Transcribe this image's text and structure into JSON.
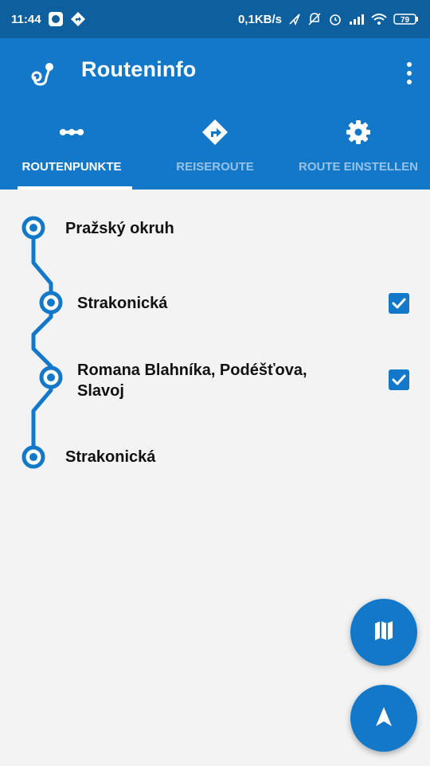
{
  "status_bar": {
    "time": "11:44",
    "network_speed": "0,1KB/s",
    "battery": "79",
    "icons": [
      "messenger-icon",
      "location-arrow-icon",
      "nfc-icon",
      "alarm-icon",
      "signal-icon",
      "wifi-icon",
      "battery-icon"
    ]
  },
  "app_bar": {
    "title": "Routeninfo",
    "logo_icon": "route-pin-icon",
    "menu_icon": "more-vert-icon"
  },
  "tabs": [
    {
      "label": "ROUTENPUNKTE",
      "icon": "dots-icon",
      "active": true
    },
    {
      "label": "REISEROUTE",
      "icon": "turn-right-diamond-icon",
      "active": false
    },
    {
      "label": "ROUTE EINSTELLEN",
      "icon": "gear-icon",
      "active": false
    }
  ],
  "waypoints": [
    {
      "name": "Pražský okruh",
      "checkable": false,
      "checked": false
    },
    {
      "name": "Strakonická",
      "checkable": true,
      "checked": true
    },
    {
      "name": "Romana Blahníka, Podéšťova,",
      "name_line2": "Slavoj",
      "checkable": true,
      "checked": true
    },
    {
      "name": "Strakonická",
      "checkable": false,
      "checked": false
    }
  ],
  "fabs": [
    {
      "icon": "map-icon"
    },
    {
      "icon": "navigation-arrow-icon"
    }
  ],
  "colors": {
    "status_bar": "#0e5f9e",
    "primary": "#1478c8",
    "background": "#f3f3f3",
    "text": "#111111"
  }
}
